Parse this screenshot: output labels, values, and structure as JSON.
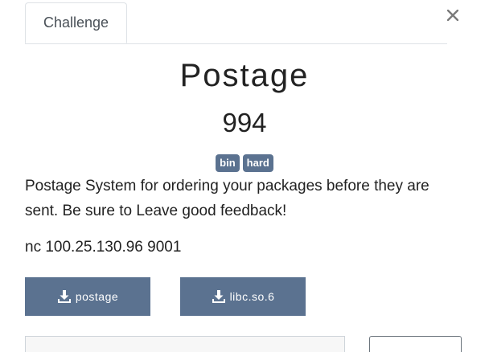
{
  "tabs": [
    {
      "label": "Challenge"
    }
  ],
  "close_symbol": "×",
  "challenge": {
    "name": "Postage",
    "points": "994",
    "tags": [
      "bin",
      "hard"
    ],
    "description": "Postage System for ordering your packages before they are sent. Be sure to Leave good feedback!",
    "connection": "nc 100.25.130.96 9001"
  },
  "files": [
    {
      "label": "postage",
      "icon": "download-icon"
    },
    {
      "label": "libc.so.6",
      "icon": "download-icon"
    }
  ],
  "colors": {
    "accent": "#5b7290",
    "text": "#222222",
    "border": "#dee2e6"
  }
}
